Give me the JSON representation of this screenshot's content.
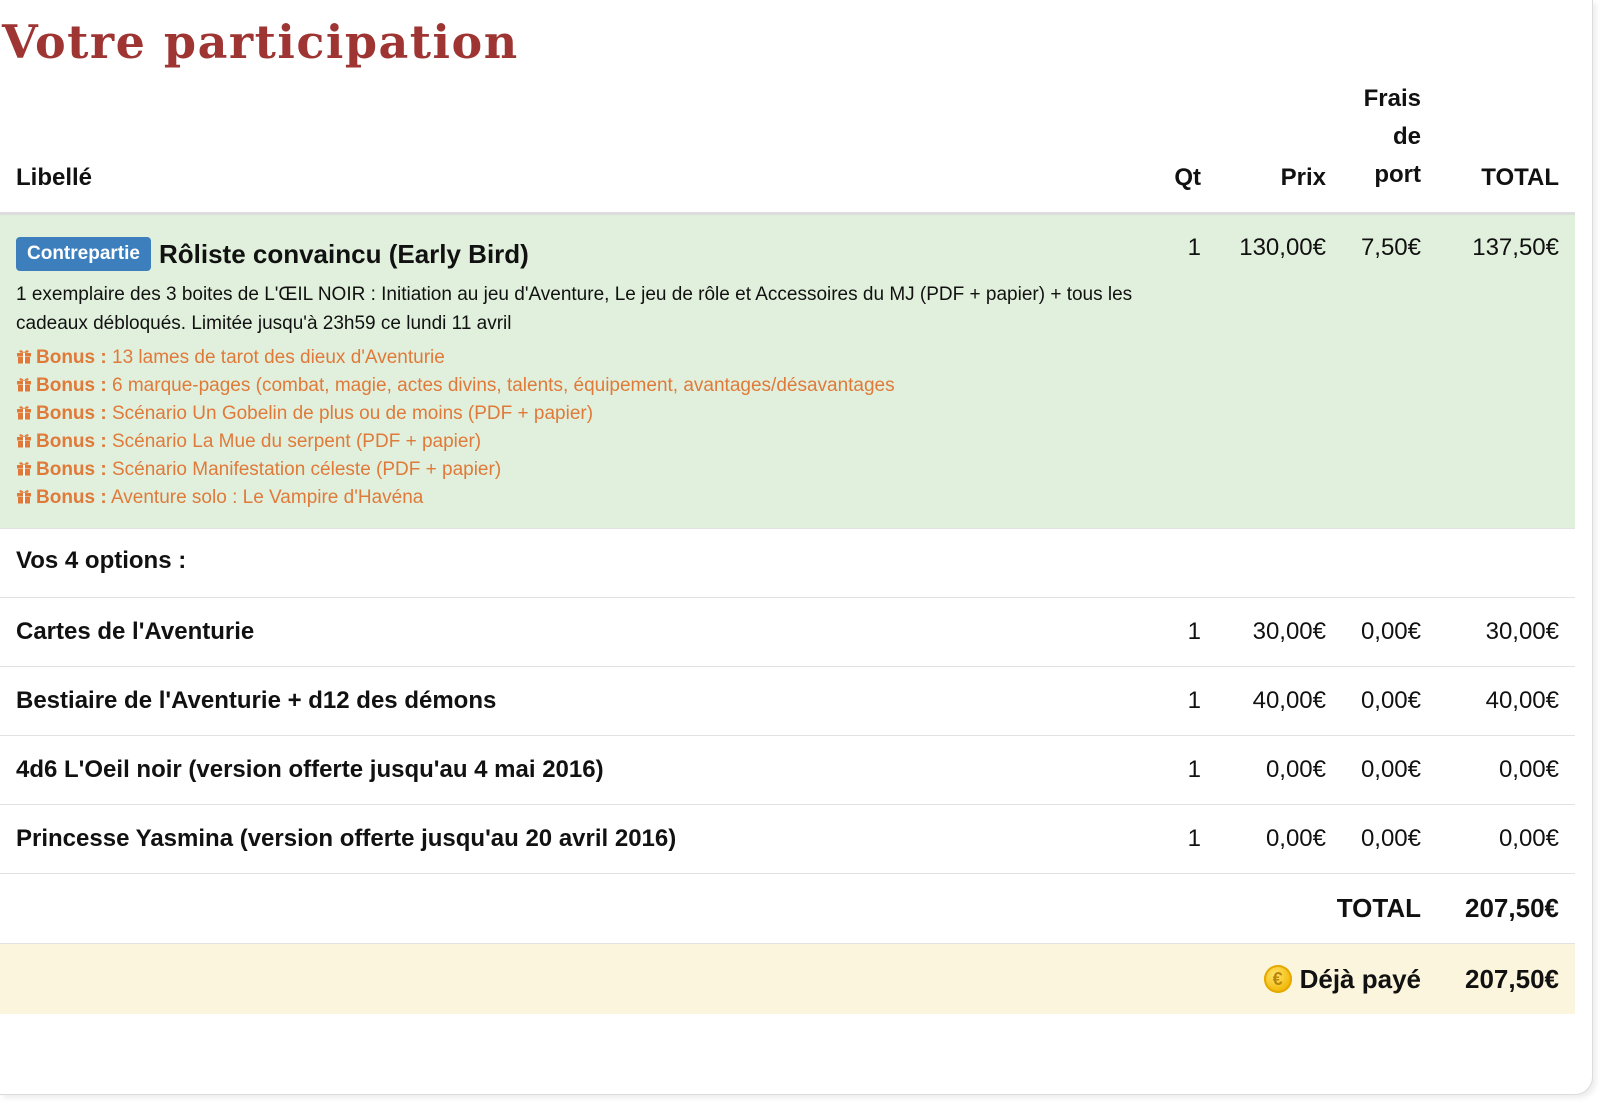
{
  "title": "Votre participation",
  "columns": {
    "libelle": "Libellé",
    "qt": "Qt",
    "prix": "Prix",
    "port": [
      "Frais",
      "de",
      "port"
    ],
    "total": "TOTAL"
  },
  "reward": {
    "badge": "Contrepartie",
    "title": "Rôliste convaincu (Early Bird)",
    "description": "1 exemplaire des 3 boites de L'ŒIL NOIR : Initiation au jeu d'Aventure, Le jeu de rôle et Accessoires du MJ (PDF + papier) + tous les cadeaux débloqués. Limitée jusqu'à 23h59 ce lundi 11 avril",
    "qt": "1",
    "prix": "130,00€",
    "port": "7,50€",
    "total": "137,50€",
    "bonus_label": "Bonus :",
    "bonuses": [
      "13 lames de tarot des dieux d'Aventurie",
      "6 marque-pages (combat, magie, actes divins, talents, équipement, avantages/désavantages",
      "Scénario Un Gobelin de plus ou de moins (PDF + papier)",
      "Scénario La Mue du serpent (PDF + papier)",
      "Scénario Manifestation céleste (PDF + papier)",
      "Aventure solo : Le Vampire d'Havéna"
    ],
    "bonus_color": "#e07a3a",
    "bonus_icon": "gift-icon"
  },
  "options_title": "Vos 4 options :",
  "options": [
    {
      "label": "Cartes de l'Aventurie",
      "qt": "1",
      "prix": "30,00€",
      "port": "0,00€",
      "total": "30,00€"
    },
    {
      "label": "Bestiaire de l'Aventurie + d12 des démons",
      "qt": "1",
      "prix": "40,00€",
      "port": "0,00€",
      "total": "40,00€"
    },
    {
      "label": "4d6 L'Oeil noir (version offerte jusqu'au 4 mai 2016)",
      "qt": "1",
      "prix": "0,00€",
      "port": "0,00€",
      "total": "0,00€"
    },
    {
      "label": "Princesse Yasmina (version offerte jusqu'au 20 avril 2016)",
      "qt": "1",
      "prix": "0,00€",
      "port": "0,00€",
      "total": "0,00€"
    }
  ],
  "summary": {
    "total_label": "TOTAL",
    "total_value": "207,50€",
    "paid_label": "Déjà payé",
    "paid_value": "207,50€",
    "paid_icon": "euro-coin-icon",
    "paid_icon_glyph": "€"
  },
  "colors": {
    "title": "#9e3533",
    "badge": "#3d7ebd",
    "reward_bg": "#e1f0dc",
    "paid_bg": "#fbf5dd"
  }
}
